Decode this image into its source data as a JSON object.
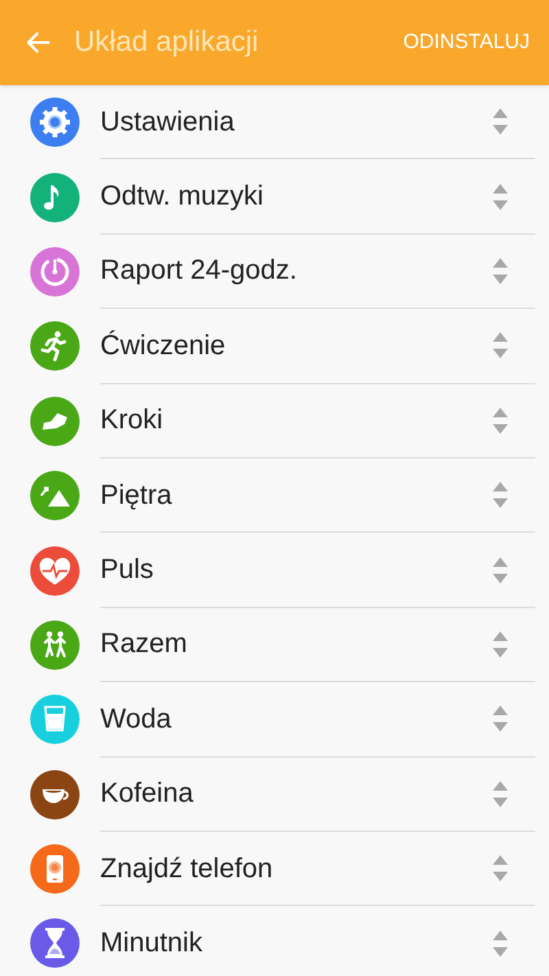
{
  "app_bar": {
    "title": "Układ aplikacji",
    "action": "ODINSTALUJ"
  },
  "items": [
    {
      "label": "Ustawienia",
      "kind": "gear",
      "color": "#3d7ff0"
    },
    {
      "label": "Odtw. muzyki",
      "kind": "note",
      "color": "#13b27b"
    },
    {
      "label": "Raport 24-godz.",
      "kind": "timer",
      "color": "#d873d8"
    },
    {
      "label": "Ćwiczenie",
      "kind": "runner",
      "color": "#4aa817"
    },
    {
      "label": "Kroki",
      "kind": "shoe",
      "color": "#4aa817"
    },
    {
      "label": "Piętra",
      "kind": "mountain",
      "color": "#4aa817"
    },
    {
      "label": "Puls",
      "kind": "heart",
      "color": "#ec4c3a"
    },
    {
      "label": "Razem",
      "kind": "walkers",
      "color": "#4aa817"
    },
    {
      "label": "Woda",
      "kind": "glass",
      "color": "#17cfdd"
    },
    {
      "label": "Kofeina",
      "kind": "cup",
      "color": "#8a4513"
    },
    {
      "label": "Znajdź telefon",
      "kind": "phone",
      "color": "#f56a1a"
    },
    {
      "label": "Minutnik",
      "kind": "hourglass",
      "color": "#6a5ae8"
    }
  ]
}
